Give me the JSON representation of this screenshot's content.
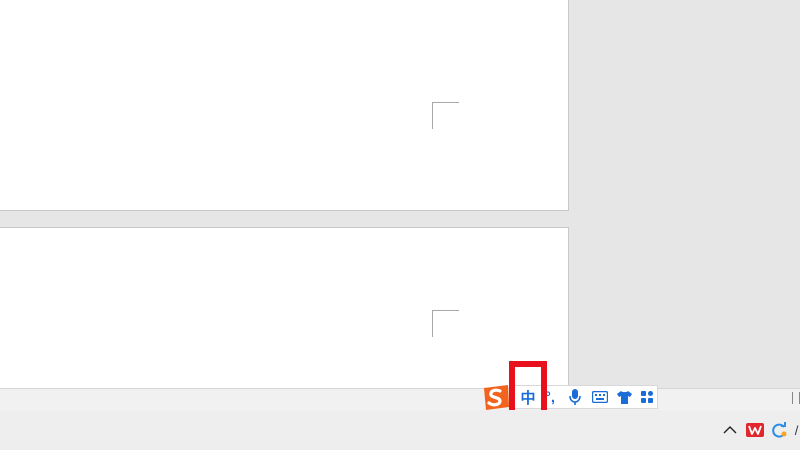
{
  "document": {
    "pages": [
      {
        "name": "page-1"
      },
      {
        "name": "page-2"
      }
    ]
  },
  "ime_toolbar": {
    "logo": "sogou-logo-icon",
    "mode_label": "中",
    "punct_label": "°,",
    "icons": [
      "microphone-icon",
      "keyboard-icon",
      "skin-shirt-icon",
      "toolbox-grid-icon"
    ],
    "accent_color": "#1a6dd6"
  },
  "highlight": {
    "color": "#e8101c",
    "target": "ime-mode-indicator"
  },
  "tray": {
    "icons": [
      "show-hidden-icons-chevron-icon",
      "wps-office-icon",
      "sync-cloud-icon"
    ],
    "overflow_label": "/"
  }
}
